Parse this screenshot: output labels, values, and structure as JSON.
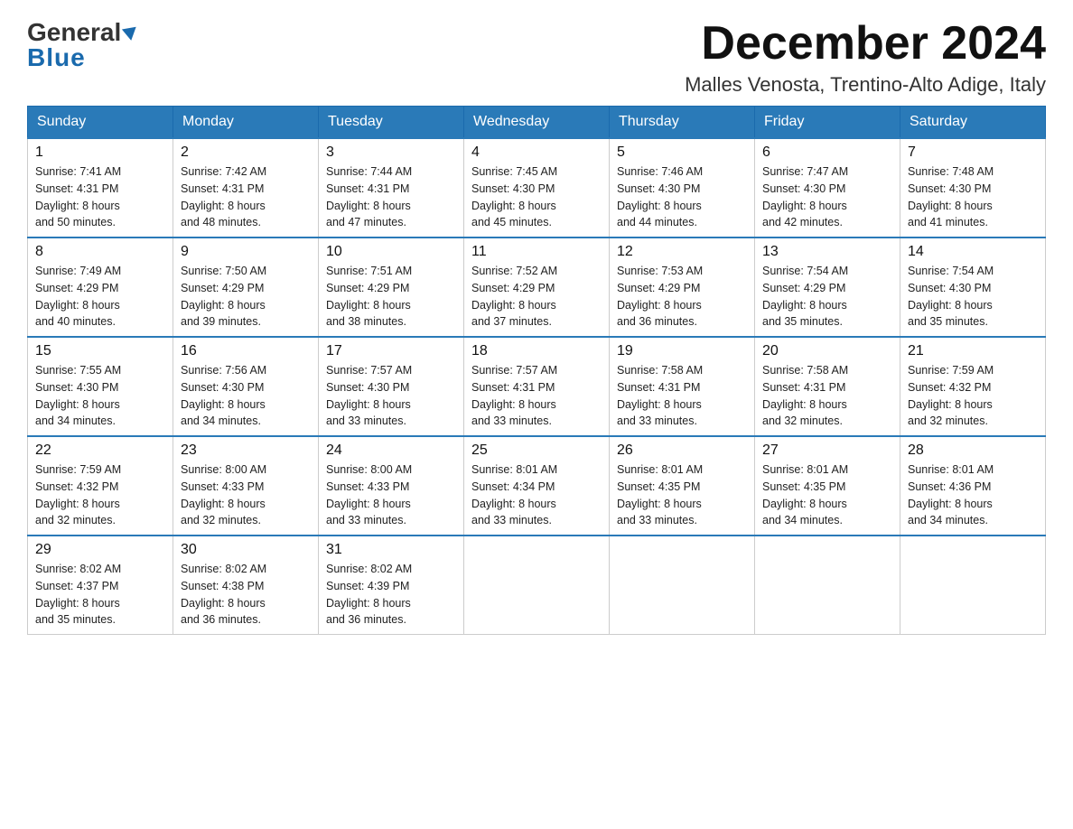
{
  "header": {
    "logo_general": "General",
    "logo_blue": "Blue",
    "month_year": "December 2024",
    "location": "Malles Venosta, Trentino-Alto Adige, Italy"
  },
  "days_of_week": [
    "Sunday",
    "Monday",
    "Tuesday",
    "Wednesday",
    "Thursday",
    "Friday",
    "Saturday"
  ],
  "weeks": [
    [
      {
        "day": "1",
        "info": "Sunrise: 7:41 AM\nSunset: 4:31 PM\nDaylight: 8 hours\nand 50 minutes."
      },
      {
        "day": "2",
        "info": "Sunrise: 7:42 AM\nSunset: 4:31 PM\nDaylight: 8 hours\nand 48 minutes."
      },
      {
        "day": "3",
        "info": "Sunrise: 7:44 AM\nSunset: 4:31 PM\nDaylight: 8 hours\nand 47 minutes."
      },
      {
        "day": "4",
        "info": "Sunrise: 7:45 AM\nSunset: 4:30 PM\nDaylight: 8 hours\nand 45 minutes."
      },
      {
        "day": "5",
        "info": "Sunrise: 7:46 AM\nSunset: 4:30 PM\nDaylight: 8 hours\nand 44 minutes."
      },
      {
        "day": "6",
        "info": "Sunrise: 7:47 AM\nSunset: 4:30 PM\nDaylight: 8 hours\nand 42 minutes."
      },
      {
        "day": "7",
        "info": "Sunrise: 7:48 AM\nSunset: 4:30 PM\nDaylight: 8 hours\nand 41 minutes."
      }
    ],
    [
      {
        "day": "8",
        "info": "Sunrise: 7:49 AM\nSunset: 4:29 PM\nDaylight: 8 hours\nand 40 minutes."
      },
      {
        "day": "9",
        "info": "Sunrise: 7:50 AM\nSunset: 4:29 PM\nDaylight: 8 hours\nand 39 minutes."
      },
      {
        "day": "10",
        "info": "Sunrise: 7:51 AM\nSunset: 4:29 PM\nDaylight: 8 hours\nand 38 minutes."
      },
      {
        "day": "11",
        "info": "Sunrise: 7:52 AM\nSunset: 4:29 PM\nDaylight: 8 hours\nand 37 minutes."
      },
      {
        "day": "12",
        "info": "Sunrise: 7:53 AM\nSunset: 4:29 PM\nDaylight: 8 hours\nand 36 minutes."
      },
      {
        "day": "13",
        "info": "Sunrise: 7:54 AM\nSunset: 4:29 PM\nDaylight: 8 hours\nand 35 minutes."
      },
      {
        "day": "14",
        "info": "Sunrise: 7:54 AM\nSunset: 4:30 PM\nDaylight: 8 hours\nand 35 minutes."
      }
    ],
    [
      {
        "day": "15",
        "info": "Sunrise: 7:55 AM\nSunset: 4:30 PM\nDaylight: 8 hours\nand 34 minutes."
      },
      {
        "day": "16",
        "info": "Sunrise: 7:56 AM\nSunset: 4:30 PM\nDaylight: 8 hours\nand 34 minutes."
      },
      {
        "day": "17",
        "info": "Sunrise: 7:57 AM\nSunset: 4:30 PM\nDaylight: 8 hours\nand 33 minutes."
      },
      {
        "day": "18",
        "info": "Sunrise: 7:57 AM\nSunset: 4:31 PM\nDaylight: 8 hours\nand 33 minutes."
      },
      {
        "day": "19",
        "info": "Sunrise: 7:58 AM\nSunset: 4:31 PM\nDaylight: 8 hours\nand 33 minutes."
      },
      {
        "day": "20",
        "info": "Sunrise: 7:58 AM\nSunset: 4:31 PM\nDaylight: 8 hours\nand 32 minutes."
      },
      {
        "day": "21",
        "info": "Sunrise: 7:59 AM\nSunset: 4:32 PM\nDaylight: 8 hours\nand 32 minutes."
      }
    ],
    [
      {
        "day": "22",
        "info": "Sunrise: 7:59 AM\nSunset: 4:32 PM\nDaylight: 8 hours\nand 32 minutes."
      },
      {
        "day": "23",
        "info": "Sunrise: 8:00 AM\nSunset: 4:33 PM\nDaylight: 8 hours\nand 32 minutes."
      },
      {
        "day": "24",
        "info": "Sunrise: 8:00 AM\nSunset: 4:33 PM\nDaylight: 8 hours\nand 33 minutes."
      },
      {
        "day": "25",
        "info": "Sunrise: 8:01 AM\nSunset: 4:34 PM\nDaylight: 8 hours\nand 33 minutes."
      },
      {
        "day": "26",
        "info": "Sunrise: 8:01 AM\nSunset: 4:35 PM\nDaylight: 8 hours\nand 33 minutes."
      },
      {
        "day": "27",
        "info": "Sunrise: 8:01 AM\nSunset: 4:35 PM\nDaylight: 8 hours\nand 34 minutes."
      },
      {
        "day": "28",
        "info": "Sunrise: 8:01 AM\nSunset: 4:36 PM\nDaylight: 8 hours\nand 34 minutes."
      }
    ],
    [
      {
        "day": "29",
        "info": "Sunrise: 8:02 AM\nSunset: 4:37 PM\nDaylight: 8 hours\nand 35 minutes."
      },
      {
        "day": "30",
        "info": "Sunrise: 8:02 AM\nSunset: 4:38 PM\nDaylight: 8 hours\nand 36 minutes."
      },
      {
        "day": "31",
        "info": "Sunrise: 8:02 AM\nSunset: 4:39 PM\nDaylight: 8 hours\nand 36 minutes."
      },
      null,
      null,
      null,
      null
    ]
  ]
}
